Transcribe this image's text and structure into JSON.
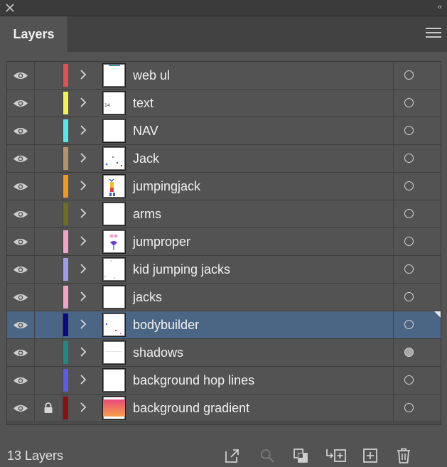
{
  "panel": {
    "tab_label": "Layers",
    "collapse_glyph": "‹‹"
  },
  "layers": [
    {
      "name": "web ul",
      "color": "#e05252",
      "thumb": "webui",
      "target": "empty",
      "locked": false,
      "selected": false
    },
    {
      "name": "text",
      "color": "#f2f252",
      "thumb": "text",
      "target": "empty",
      "locked": false,
      "selected": false
    },
    {
      "name": "NAV",
      "color": "#53e8f0",
      "thumb": "blank",
      "target": "empty",
      "locked": false,
      "selected": false
    },
    {
      "name": "Jack",
      "color": "#b6926c",
      "thumb": "jack",
      "target": "empty",
      "locked": false,
      "selected": false
    },
    {
      "name": "jumpingjack",
      "color": "#f09820",
      "thumb": "jumpingjack",
      "target": "empty",
      "locked": false,
      "selected": false
    },
    {
      "name": "arms",
      "color": "#6e6e1e",
      "thumb": "blank",
      "target": "empty",
      "locked": false,
      "selected": false
    },
    {
      "name": "jumproper",
      "color": "#f2a4c8",
      "thumb": "jumproper",
      "target": "empty",
      "locked": false,
      "selected": false
    },
    {
      "name": "kid jumping jacks",
      "color": "#9c9cea",
      "thumb": "kid",
      "target": "empty",
      "locked": false,
      "selected": false
    },
    {
      "name": "jacks",
      "color": "#f2a4c8",
      "thumb": "blank",
      "target": "empty",
      "locked": false,
      "selected": false
    },
    {
      "name": "bodybuilder",
      "color": "#0a0a82",
      "thumb": "bodybuilder",
      "target": "empty",
      "locked": false,
      "selected": true
    },
    {
      "name": "shadows",
      "color": "#1e8a86",
      "thumb": "shadows",
      "target": "filled",
      "locked": false,
      "selected": false
    },
    {
      "name": "background hop lines",
      "color": "#5c5ce6",
      "thumb": "blank",
      "target": "empty",
      "locked": false,
      "selected": false
    },
    {
      "name": "background gradient",
      "color": "#8a1010",
      "thumb": "gradient",
      "target": "empty",
      "locked": true,
      "selected": false
    }
  ],
  "footer": {
    "count_label": "13 Layers",
    "buttons": [
      "export-icon",
      "locate-object-icon",
      "clipping-mask-icon",
      "new-sublayer-icon",
      "new-layer-icon",
      "trash-icon"
    ]
  }
}
